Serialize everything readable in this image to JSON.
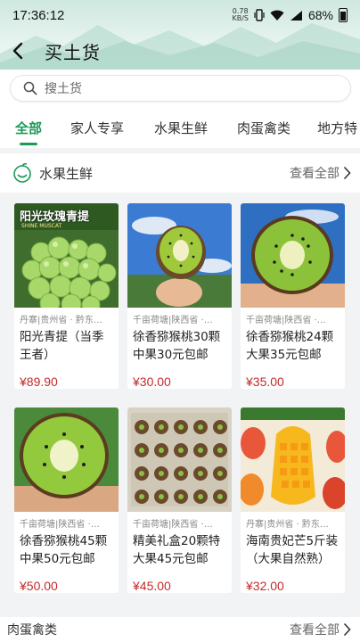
{
  "status": {
    "time": "17:36:12",
    "net_speed_value": "0.78",
    "net_speed_unit": "KB/S",
    "battery": "68%"
  },
  "header": {
    "title": "买土货"
  },
  "search": {
    "placeholder": "搜土货"
  },
  "tabs": [
    {
      "label": "全部",
      "active": true
    },
    {
      "label": "家人专享",
      "active": false
    },
    {
      "label": "水果生鲜",
      "active": false
    },
    {
      "label": "肉蛋禽类",
      "active": false
    },
    {
      "label": "地方特",
      "active": false
    }
  ],
  "section": {
    "title": "水果生鲜",
    "view_all": "查看全部"
  },
  "products": [
    {
      "image_text": "阳光玫瑰青提",
      "image_subtext": "SHINE MUSCAT",
      "location": "丹寨|贵州省 · 黔东…",
      "name": "阳光青提（当季王者）",
      "price": "¥89.90"
    },
    {
      "location": "千亩荷塘|陕西省 ·…",
      "name": "徐香猕猴桃30颗中果30元包邮",
      "price": "¥30.00"
    },
    {
      "location": "千亩荷塘|陕西省 ·…",
      "name": "徐香猕猴桃24颗大果35元包邮",
      "price": "¥35.00"
    },
    {
      "location": "千亩荷塘|陕西省 ·…",
      "name": "徐香猕猴桃45颗中果50元包邮",
      "price": "¥50.00"
    },
    {
      "location": "千亩荷塘|陕西省 ·…",
      "name": "精美礼盒20颗特大果45元包邮",
      "price": "¥45.00"
    },
    {
      "location": "丹寨|贵州省 · 黔东…",
      "name": "海南贵妃芒5斤装（大果自然熟）",
      "price": "¥32.00"
    }
  ],
  "next_section": {
    "title": "肉蛋禽类",
    "view_all": "查看全部"
  },
  "colors": {
    "accent": "#1c9a57",
    "price": "#c62a2a"
  }
}
